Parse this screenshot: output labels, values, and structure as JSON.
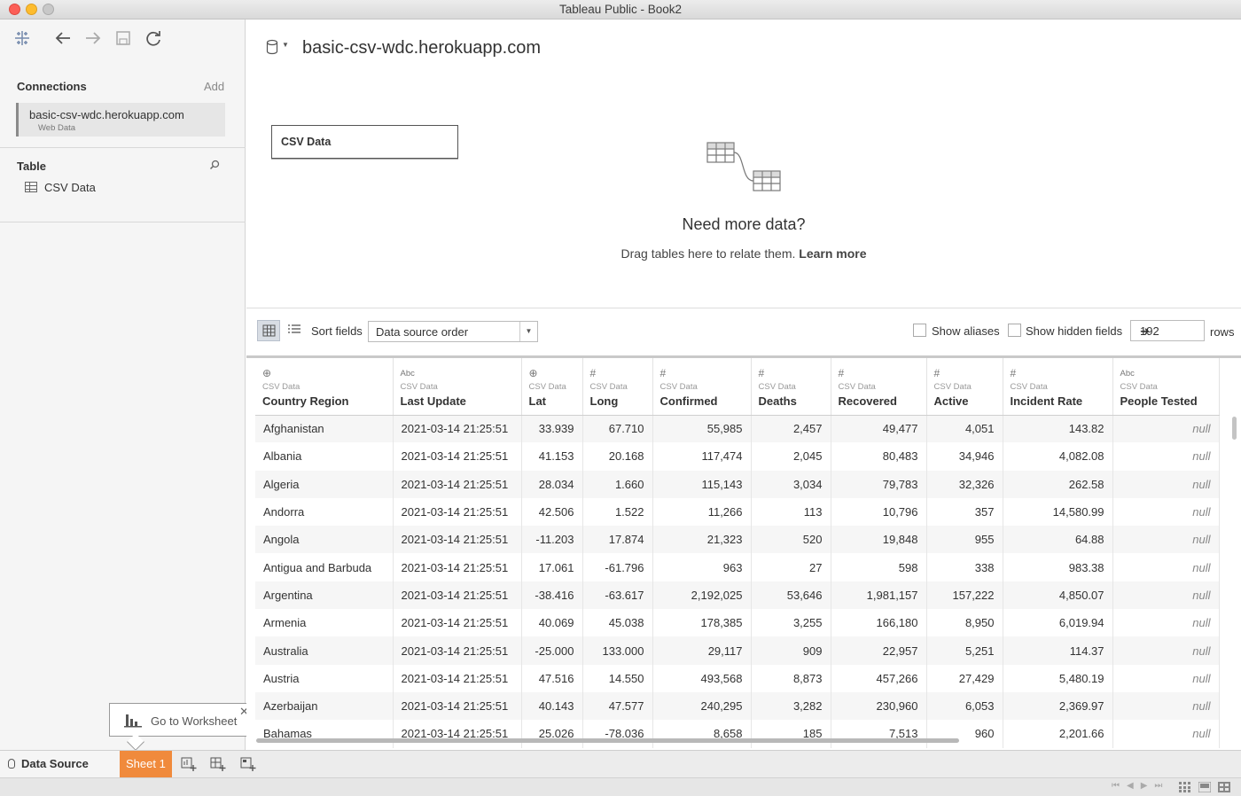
{
  "window": {
    "title": "Tableau Public - Book2"
  },
  "left_panel": {
    "connections_header": "Connections",
    "add_label": "Add",
    "connection": {
      "name": "basic-csv-wdc.herokuapp.com",
      "type": "Web Data"
    },
    "table_header": "Table",
    "table_item": "CSV Data"
  },
  "tooltip": {
    "label": "Go to Worksheet"
  },
  "canvas": {
    "datasource_title": "basic-csv-wdc.herokuapp.com",
    "table_box": "CSV Data",
    "need_more_title": "Need more data?",
    "need_more_text": "Drag tables here to relate them.",
    "learn_more": "Learn more"
  },
  "grid_toolbar": {
    "sort_label": "Sort fields",
    "sort_value": "Data source order",
    "show_aliases": "Show aliases",
    "show_hidden": "Show hidden fields",
    "rows_value": "192",
    "rows_label": "rows"
  },
  "grid": {
    "columns": [
      {
        "type_icon": "globe-icon",
        "type_glyph": "⊕",
        "source": "CSV Data",
        "name": "Country Region"
      },
      {
        "type_icon": "string-icon",
        "type_glyph": "Abc",
        "source": "CSV Data",
        "name": "Last Update"
      },
      {
        "type_icon": "globe-icon",
        "type_glyph": "⊕",
        "source": "CSV Data",
        "name": "Lat"
      },
      {
        "type_icon": "number-icon",
        "type_glyph": "#",
        "source": "CSV Data",
        "name": "Long"
      },
      {
        "type_icon": "number-icon",
        "type_glyph": "#",
        "source": "CSV Data",
        "name": "Confirmed"
      },
      {
        "type_icon": "number-icon",
        "type_glyph": "#",
        "source": "CSV Data",
        "name": "Deaths"
      },
      {
        "type_icon": "number-icon",
        "type_glyph": "#",
        "source": "CSV Data",
        "name": "Recovered"
      },
      {
        "type_icon": "number-icon",
        "type_glyph": "#",
        "source": "CSV Data",
        "name": "Active"
      },
      {
        "type_icon": "number-icon",
        "type_glyph": "#",
        "source": "CSV Data",
        "name": "Incident Rate"
      },
      {
        "type_icon": "string-icon",
        "type_glyph": "Abc",
        "source": "CSV Data",
        "name": "People Tested"
      }
    ],
    "rows": [
      [
        "Afghanistan",
        "2021-03-14 21:25:51",
        "33.939",
        "67.710",
        "55,985",
        "2,457",
        "49,477",
        "4,051",
        "143.82",
        "null"
      ],
      [
        "Albania",
        "2021-03-14 21:25:51",
        "41.153",
        "20.168",
        "117,474",
        "2,045",
        "80,483",
        "34,946",
        "4,082.08",
        "null"
      ],
      [
        "Algeria",
        "2021-03-14 21:25:51",
        "28.034",
        "1.660",
        "115,143",
        "3,034",
        "79,783",
        "32,326",
        "262.58",
        "null"
      ],
      [
        "Andorra",
        "2021-03-14 21:25:51",
        "42.506",
        "1.522",
        "11,266",
        "113",
        "10,796",
        "357",
        "14,580.99",
        "null"
      ],
      [
        "Angola",
        "2021-03-14 21:25:51",
        "-11.203",
        "17.874",
        "21,323",
        "520",
        "19,848",
        "955",
        "64.88",
        "null"
      ],
      [
        "Antigua and Barbuda",
        "2021-03-14 21:25:51",
        "17.061",
        "-61.796",
        "963",
        "27",
        "598",
        "338",
        "983.38",
        "null"
      ],
      [
        "Argentina",
        "2021-03-14 21:25:51",
        "-38.416",
        "-63.617",
        "2,192,025",
        "53,646",
        "1,981,157",
        "157,222",
        "4,850.07",
        "null"
      ],
      [
        "Armenia",
        "2021-03-14 21:25:51",
        "40.069",
        "45.038",
        "178,385",
        "3,255",
        "166,180",
        "8,950",
        "6,019.94",
        "null"
      ],
      [
        "Australia",
        "2021-03-14 21:25:51",
        "-25.000",
        "133.000",
        "29,117",
        "909",
        "22,957",
        "5,251",
        "114.37",
        "null"
      ],
      [
        "Austria",
        "2021-03-14 21:25:51",
        "47.516",
        "14.550",
        "493,568",
        "8,873",
        "457,266",
        "27,429",
        "5,480.19",
        "null"
      ],
      [
        "Azerbaijan",
        "2021-03-14 21:25:51",
        "40.143",
        "47.577",
        "240,295",
        "3,282",
        "230,960",
        "6,053",
        "2,369.97",
        "null"
      ],
      [
        "Bahamas",
        "2021-03-14 21:25:51",
        "25.026",
        "-78.036",
        "8,658",
        "185",
        "7,513",
        "960",
        "2,201.66",
        "null"
      ]
    ]
  },
  "tabs": {
    "data_source": "Data Source",
    "sheet": "Sheet 1"
  },
  "colors": {
    "sheet_tab": "#f08a3c",
    "accent_selected": "#d8dde4"
  }
}
